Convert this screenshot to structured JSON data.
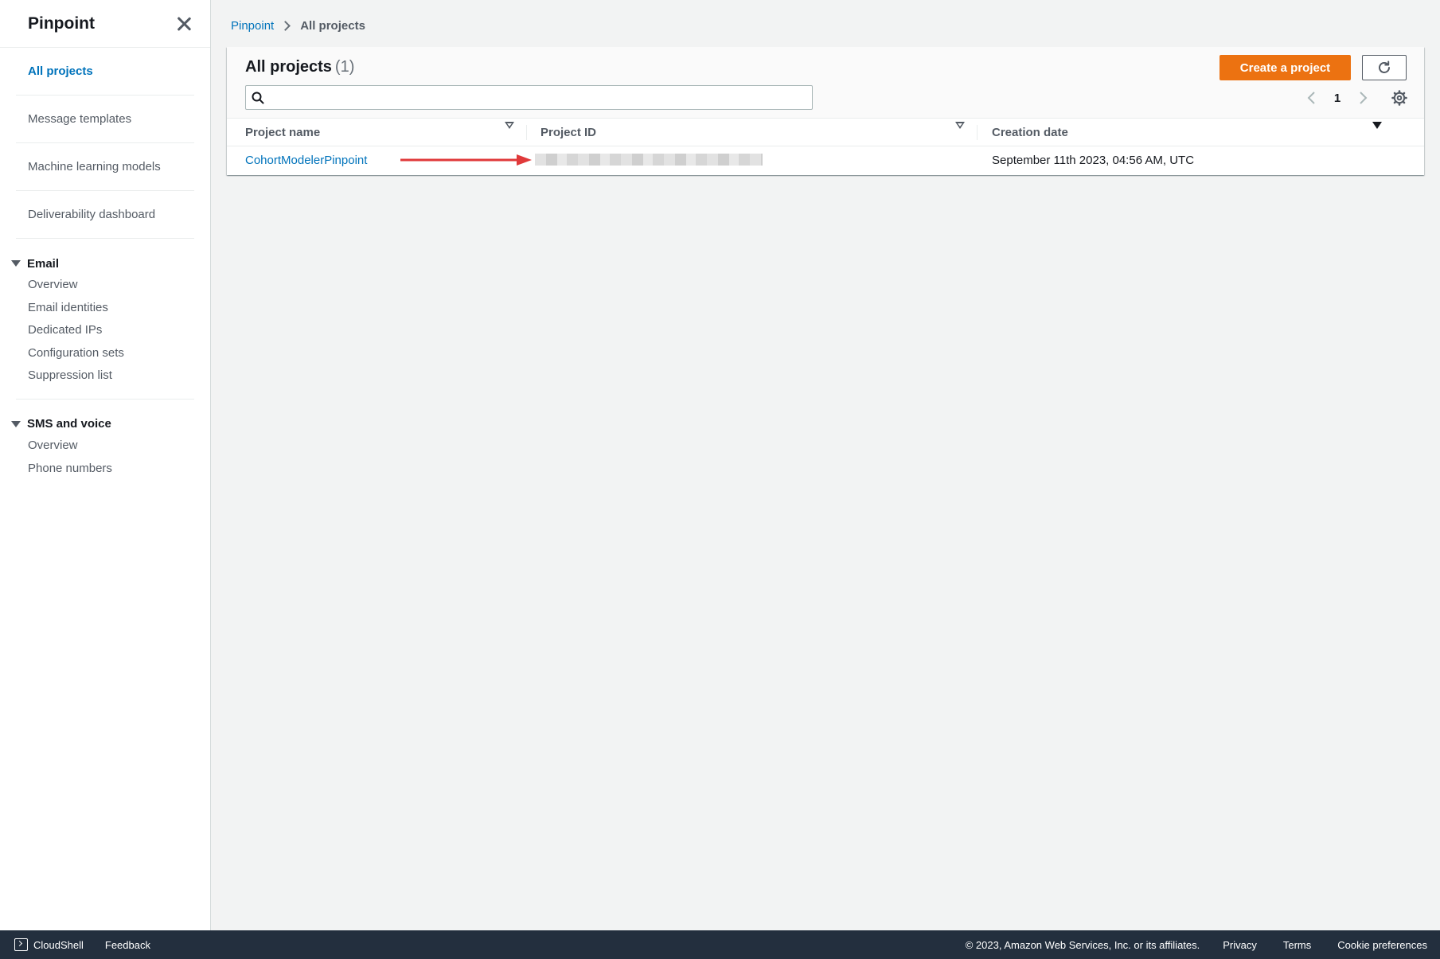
{
  "sidebar": {
    "title": "Pinpoint",
    "links": [
      {
        "label": "All projects",
        "active": true
      },
      {
        "label": "Message templates",
        "active": false
      },
      {
        "label": "Machine learning models",
        "active": false
      },
      {
        "label": "Deliverability dashboard",
        "active": false
      }
    ],
    "email": {
      "header": "Email",
      "items": [
        "Overview",
        "Email identities",
        "Dedicated IPs",
        "Configuration sets",
        "Suppression list"
      ]
    },
    "sms": {
      "header": "SMS and voice",
      "items": [
        "Overview",
        "Phone numbers"
      ]
    }
  },
  "breadcrumb": {
    "root": "Pinpoint",
    "current": "All projects"
  },
  "table": {
    "title": "All projects",
    "count": "(1)",
    "create_button": "Create a project",
    "search_placeholder": "",
    "page": "1",
    "columns": [
      "Project name",
      "Project ID",
      "Creation date"
    ],
    "rows": [
      {
        "name": "CohortModelerPinpoint",
        "id": "",
        "created": "September 11th 2023, 04:56 AM, UTC"
      }
    ]
  },
  "footer": {
    "cloudshell": "CloudShell",
    "feedback": "Feedback",
    "copyright": "© 2023, Amazon Web Services, Inc. or its affiliates.",
    "privacy": "Privacy",
    "terms": "Terms",
    "cookies": "Cookie preferences"
  },
  "colors": {
    "accent": "#0073bb",
    "primary_button": "#ec7211",
    "footer_bg": "#232f3e",
    "annotation_arrow": "#e0393a"
  }
}
